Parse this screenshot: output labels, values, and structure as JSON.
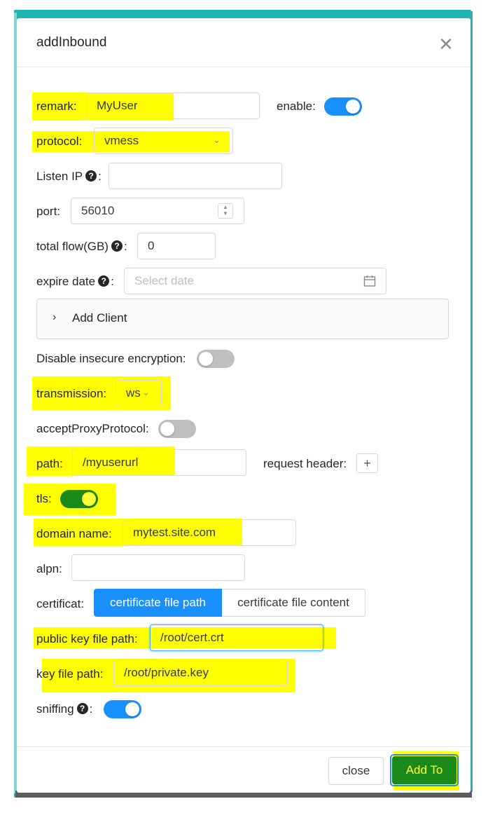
{
  "dialog": {
    "title": "addInbound",
    "close_glyph": "✕"
  },
  "fields": {
    "remark": {
      "label": "remark",
      "value": "MyUser"
    },
    "enable": {
      "label": "enable",
      "on": true
    },
    "protocol": {
      "label": "protocol",
      "value": "vmess"
    },
    "listen_ip": {
      "label": "Listen IP",
      "value": ""
    },
    "port": {
      "label": "port",
      "value": "56010"
    },
    "total_flow": {
      "label": "total flow(GB)",
      "value": "0"
    },
    "expire_date": {
      "label": "expire date",
      "placeholder": "Select date"
    },
    "add_client": {
      "label": "Add Client"
    },
    "disable_insecure": {
      "label": "Disable insecure encryption",
      "on": false
    },
    "transmission": {
      "label": "transmission",
      "value": "ws"
    },
    "accept_proxy": {
      "label": "acceptProxyProtocol",
      "on": false
    },
    "path": {
      "label": "path",
      "value": "/myuserurl"
    },
    "request_header": {
      "label": "request header",
      "button": "+"
    },
    "tls": {
      "label": "tls",
      "on": true
    },
    "domain_name": {
      "label": "domain name",
      "value": "mytest.site.com"
    },
    "alpn": {
      "label": "alpn",
      "value": ""
    },
    "certificat": {
      "label": "certificat",
      "options": [
        "certificate file path",
        "certificate file content"
      ],
      "selected": "certificate file path"
    },
    "public_key_path": {
      "label": "public key file path",
      "value": "/root/cert.crt"
    },
    "key_file_path": {
      "label": "key file path",
      "value": "/root/private.key"
    },
    "sniffing": {
      "label": "sniffing",
      "on": true
    }
  },
  "footer": {
    "close_label": "close",
    "add_label": "Add To"
  },
  "colors": {
    "highlight": "#ffff00",
    "primary": "#1890ff",
    "tls_switch": "#1a8a1a",
    "add_button": "#1a8a1a",
    "frame": "#1fb5b0"
  },
  "icons": {
    "help": "question-circle-icon",
    "calendar": "calendar-icon",
    "chevron": "chevron-down-icon",
    "expand": "chevron-right-icon",
    "close": "close-icon"
  }
}
